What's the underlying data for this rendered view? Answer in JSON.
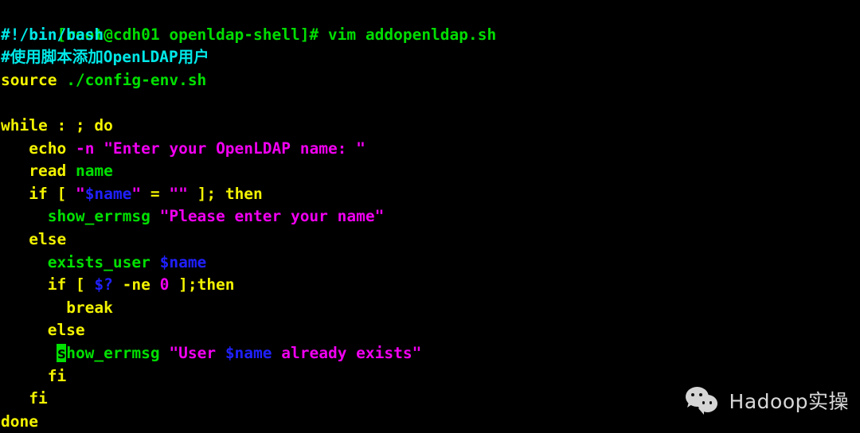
{
  "terminal": {
    "shell_prompt": "[root@cdh01 openldap-shell]# ",
    "command": "vim addopenldap.sh",
    "filename": "addopenldap.sh",
    "editor": "vim",
    "background_color": "#000000",
    "colors": {
      "prompt_green": "#00dd00",
      "keyword_yellow": "#f2f200",
      "string_magenta": "#f000f0",
      "variable_blue": "#2020ff",
      "comment_cyan": "#00e8e8",
      "function_green": "#00e000",
      "cursor_green": "#00e000"
    },
    "cursor": {
      "line": 15,
      "column": 9,
      "char": "s",
      "style": "block"
    },
    "script_lines": [
      {
        "indent": 0,
        "tokens": [
          {
            "t": "#!/bin/bash",
            "c": "c-shebang"
          }
        ]
      },
      {
        "indent": 0,
        "tokens": [
          {
            "t": "#使用脚本添加OpenLDAP用户",
            "c": "c-comment"
          }
        ]
      },
      {
        "indent": 0,
        "tokens": [
          {
            "t": "source",
            "c": "c-kw"
          },
          {
            "t": " ./config-env.sh",
            "c": "c-plain"
          }
        ]
      },
      {
        "indent": 0,
        "tokens": []
      },
      {
        "indent": 0,
        "tokens": [
          {
            "t": "while",
            "c": "c-kw"
          },
          {
            "t": " : ; ",
            "c": "c-kw"
          },
          {
            "t": "do",
            "c": "c-kw"
          }
        ]
      },
      {
        "indent": 3,
        "tokens": [
          {
            "t": "echo",
            "c": "c-kw"
          },
          {
            "t": " ",
            "c": "c-plain"
          },
          {
            "t": "-n",
            "c": "c-opt"
          },
          {
            "t": " ",
            "c": "c-plain"
          },
          {
            "t": "\"Enter your OpenLDAP name: \"",
            "c": "c-str"
          }
        ]
      },
      {
        "indent": 3,
        "tokens": [
          {
            "t": "read",
            "c": "c-kw"
          },
          {
            "t": " ",
            "c": "c-plain"
          },
          {
            "t": "name",
            "c": "c-fn"
          }
        ]
      },
      {
        "indent": 3,
        "tokens": [
          {
            "t": "if [ ",
            "c": "c-kw"
          },
          {
            "t": "\"",
            "c": "c-str"
          },
          {
            "t": "$name",
            "c": "c-var"
          },
          {
            "t": "\"",
            "c": "c-str"
          },
          {
            "t": " = ",
            "c": "c-kw"
          },
          {
            "t": "\"\"",
            "c": "c-str"
          },
          {
            "t": " ]; ",
            "c": "c-kw"
          },
          {
            "t": "then",
            "c": "c-kw"
          }
        ]
      },
      {
        "indent": 5,
        "tokens": [
          {
            "t": "show_errmsg",
            "c": "c-fn"
          },
          {
            "t": " ",
            "c": "c-plain"
          },
          {
            "t": "\"Please enter your name\"",
            "c": "c-str"
          }
        ]
      },
      {
        "indent": 3,
        "tokens": [
          {
            "t": "else",
            "c": "c-kw"
          }
        ]
      },
      {
        "indent": 5,
        "tokens": [
          {
            "t": "exists_user",
            "c": "c-fn"
          },
          {
            "t": " ",
            "c": "c-plain"
          },
          {
            "t": "$name",
            "c": "c-var"
          }
        ]
      },
      {
        "indent": 5,
        "tokens": [
          {
            "t": "if [ ",
            "c": "c-kw"
          },
          {
            "t": "$?",
            "c": "c-var"
          },
          {
            "t": " -ne ",
            "c": "c-kw"
          },
          {
            "t": "0",
            "c": "c-num"
          },
          {
            "t": " ];",
            "c": "c-kw"
          },
          {
            "t": "then",
            "c": "c-kw"
          }
        ]
      },
      {
        "indent": 7,
        "tokens": [
          {
            "t": "break",
            "c": "c-kw"
          }
        ]
      },
      {
        "indent": 5,
        "tokens": [
          {
            "t": "else",
            "c": "c-kw"
          }
        ]
      },
      {
        "indent": 6,
        "tokens": [
          {
            "t": "s",
            "c": "c-fn cursor"
          },
          {
            "t": "how_errmsg",
            "c": "c-fn"
          },
          {
            "t": " ",
            "c": "c-plain"
          },
          {
            "t": "\"User ",
            "c": "c-str"
          },
          {
            "t": "$name",
            "c": "c-var"
          },
          {
            "t": " already exists\"",
            "c": "c-str"
          }
        ]
      },
      {
        "indent": 5,
        "tokens": [
          {
            "t": "fi",
            "c": "c-kw"
          }
        ]
      },
      {
        "indent": 3,
        "tokens": [
          {
            "t": "fi",
            "c": "c-kw"
          }
        ]
      },
      {
        "indent": 0,
        "tokens": [
          {
            "t": "done",
            "c": "c-kw"
          }
        ]
      }
    ]
  },
  "watermark": {
    "label": "Hadoop实操",
    "icon": "wechat-icon"
  }
}
